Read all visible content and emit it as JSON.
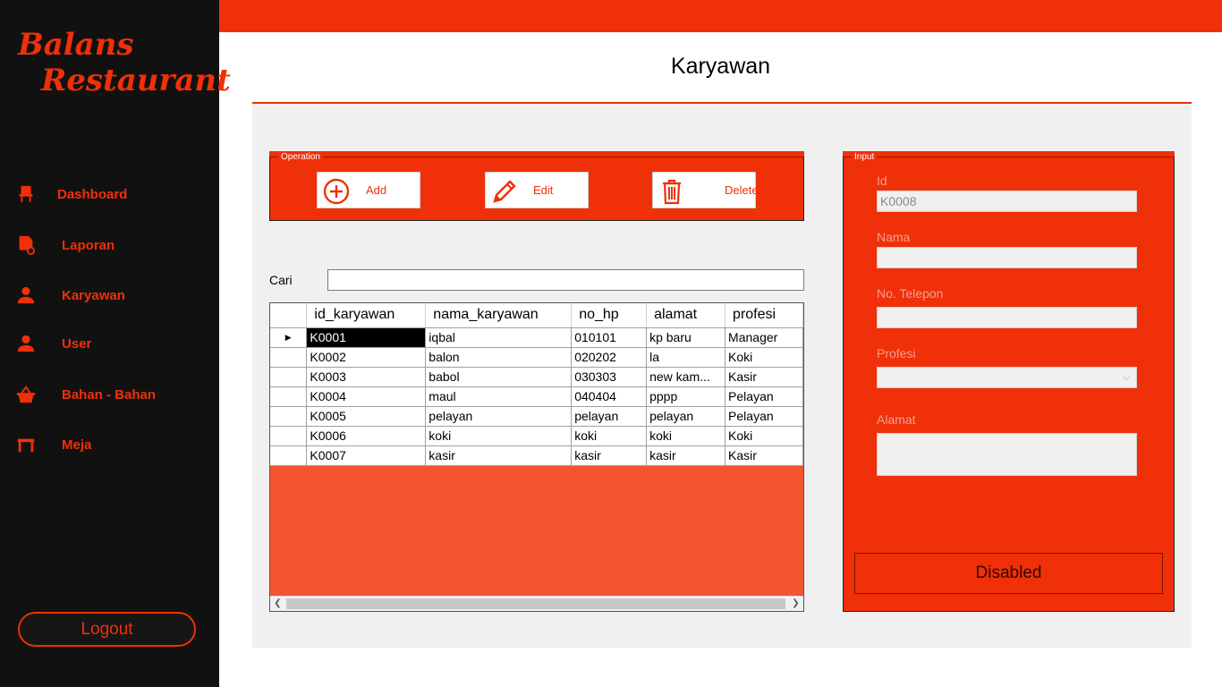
{
  "brand": {
    "line1": "Balans",
    "line2": "Restaurant"
  },
  "sidebar": {
    "items": [
      {
        "label": "Dashboard",
        "icon": "chair-icon"
      },
      {
        "label": "Laporan",
        "icon": "report-icon"
      },
      {
        "label": "Karyawan",
        "icon": "person-icon"
      },
      {
        "label": "User",
        "icon": "person-icon"
      },
      {
        "label": "Bahan - Bahan",
        "icon": "basket-icon"
      },
      {
        "label": "Meja",
        "icon": "table-icon"
      }
    ],
    "logout_label": "Logout"
  },
  "page": {
    "title": "Karyawan"
  },
  "operation": {
    "legend": "Operation",
    "add_label": "Add",
    "edit_label": "Edit",
    "delete_label": "Delete"
  },
  "search": {
    "label": "Cari",
    "value": ""
  },
  "grid": {
    "columns": [
      "id_karyawan",
      "nama_karyawan",
      "no_hp",
      "alamat",
      "profesi"
    ],
    "rows": [
      [
        "K0001",
        "iqbal",
        "010101",
        "kp baru",
        "Manager"
      ],
      [
        "K0002",
        "balon",
        "020202",
        "la",
        "Koki"
      ],
      [
        "K0003",
        "babol",
        "030303",
        "new kam...",
        "Kasir"
      ],
      [
        "K0004",
        "maul",
        "040404",
        "pppp",
        "Pelayan"
      ],
      [
        "K0005",
        "pelayan",
        "pelayan",
        "pelayan",
        "Pelayan"
      ],
      [
        "K0006",
        "koki",
        "koki",
        "koki",
        "Koki"
      ],
      [
        "K0007",
        "kasir",
        "kasir",
        "kasir",
        "Kasir"
      ]
    ],
    "current_row_marker": "▶"
  },
  "input": {
    "legend": "Input",
    "id_label": "Id",
    "id_value": "K0008",
    "nama_label": "Nama",
    "nama_value": "",
    "telepon_label": "No. Telepon",
    "telepon_value": "",
    "profesi_label": "Profesi",
    "profesi_value": "",
    "alamat_label": "Alamat",
    "alamat_value": "",
    "submit_label": "Disabled"
  },
  "colors": {
    "accent": "#f03008",
    "sidebar_bg": "#111111",
    "grid_bg": "#f25530"
  }
}
